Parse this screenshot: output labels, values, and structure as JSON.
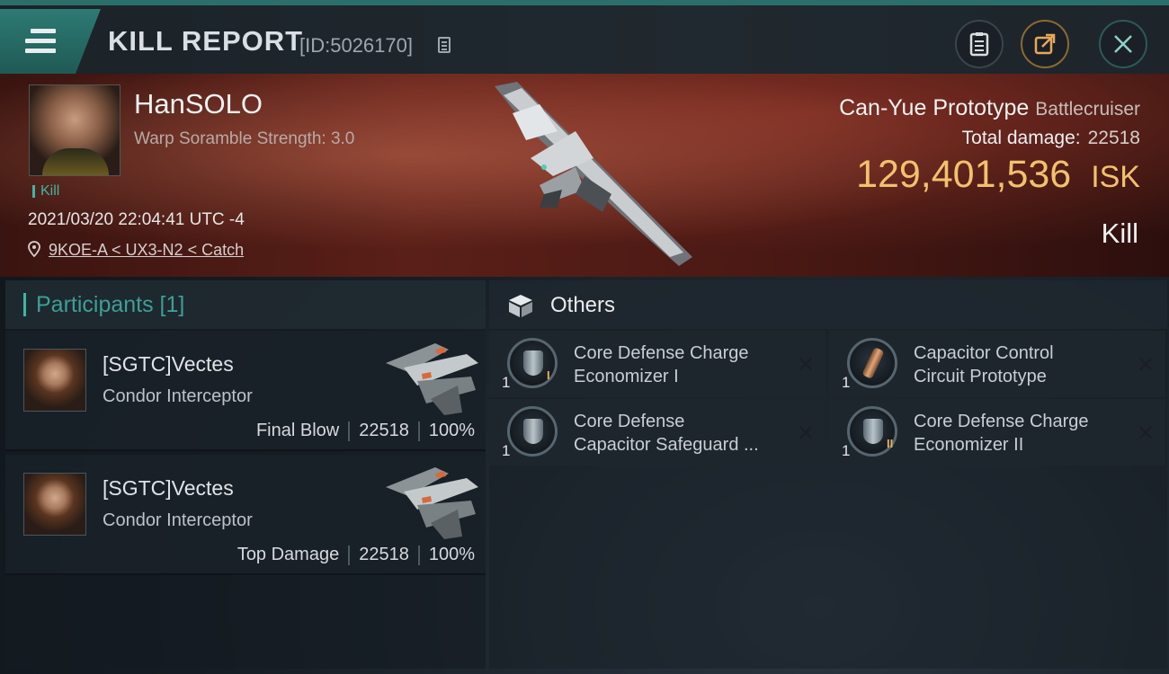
{
  "header": {
    "title": "KILL REPORT",
    "report_id": "[ID:5026170]"
  },
  "victim": {
    "name": "HanSOLO",
    "warp_scramble": "Warp Soramble Strength: 3.0",
    "tag": "Kill",
    "timestamp": "2021/03/20 22:04:41 UTC -4",
    "location": "9KOE-A < UX3-N2 < Catch"
  },
  "ship": {
    "name": "Can-Yue Prototype",
    "class": "Battlecruiser",
    "total_damage_label": "Total damage:",
    "total_damage": "22518",
    "value": "129,401,536",
    "currency": "ISK",
    "outcome": "Kill"
  },
  "participants": {
    "label": "Participants [1]",
    "rows": [
      {
        "name": "[SGTC]Vectes",
        "ship": "Condor Interceptor",
        "role": "Final Blow",
        "damage": "22518",
        "percent": "100%"
      },
      {
        "name": "[SGTC]Vectes",
        "ship": "Condor Interceptor",
        "role": "Top Damage",
        "damage": "22518",
        "percent": "100%"
      }
    ]
  },
  "others": {
    "label": "Others",
    "items": [
      {
        "qty": "1",
        "name": "Core Defense Charge\nEconomizer I",
        "tier": "I"
      },
      {
        "qty": "1",
        "name": "Capacitor Control\nCircuit Prototype",
        "tier": ""
      },
      {
        "qty": "1",
        "name": "Core Defense\nCapacitor Safeguard ...",
        "tier": ""
      },
      {
        "qty": "1",
        "name": "Core Defense Charge\nEconomizer II",
        "tier": "II"
      }
    ],
    "close_glyph": "✕"
  },
  "colors": {
    "accent": "#3fb5a6",
    "isk": "#f3c16e",
    "hero_red": "#5a1f18"
  }
}
